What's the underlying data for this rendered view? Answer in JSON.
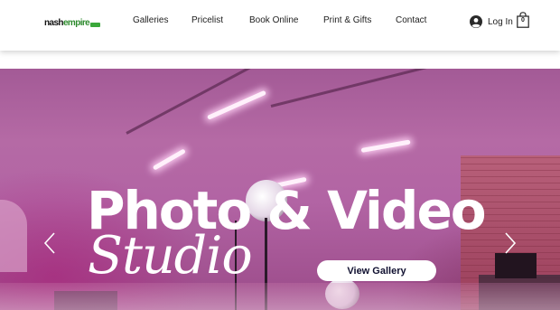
{
  "header": {
    "logo": {
      "primary": "nash",
      "accent": "empire"
    },
    "nav": [
      {
        "label": "Galleries"
      },
      {
        "label": "Pricelist"
      },
      {
        "label": "Book Online"
      },
      {
        "label": "Print & Gifts"
      },
      {
        "label": "Contact"
      }
    ],
    "login_label": "Log In",
    "cart_count": "0"
  },
  "hero": {
    "title": "Photo & Video",
    "subtitle": "Studio",
    "cta_label": "View Gallery",
    "colors": {
      "overlay": "#b264a4",
      "button_bg": "#ffffff",
      "button_text": "#101030"
    }
  },
  "icons": {
    "user": "user-circle-icon",
    "cart": "shopping-bag-icon",
    "prev": "chevron-left-icon",
    "next": "chevron-right-icon"
  }
}
